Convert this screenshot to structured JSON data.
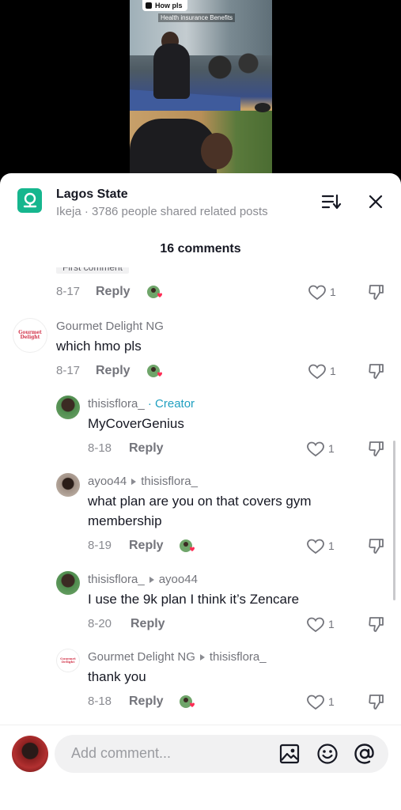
{
  "video": {
    "badge": "How pls",
    "caption": "Health insurance Benefits"
  },
  "header": {
    "title": "Lagos State",
    "subtitle": "Ikeja · 3786 people shared related posts",
    "comment_count": "16 comments"
  },
  "comments": {
    "first_tag": "First comment",
    "items": [
      {
        "user": "",
        "text": "",
        "date": "8-17",
        "reply": "Reply",
        "likes": "1"
      },
      {
        "user": "Gourmet Delight NG",
        "text": "which hmo pls",
        "date": "8-17",
        "reply": "Reply",
        "likes": "1"
      },
      {
        "user": "thisisflora_",
        "creator": "· Creator",
        "text": "MyCoverGenius",
        "date": "8-18",
        "reply": "Reply",
        "likes": "1"
      },
      {
        "user": "ayoo44",
        "reply_to": "thisisflora_",
        "text": "what plan are you on that covers gym",
        "text2": "membership",
        "date": "8-19",
        "reply": "Reply",
        "likes": "1"
      },
      {
        "user": "thisisflora_",
        "reply_to": "ayoo44",
        "text": "I use the 9k plan I think it’s Zencare",
        "date": "8-20",
        "reply": "Reply",
        "likes": "1"
      },
      {
        "user": "Gourmet Delight NG",
        "reply_to": "thisisflora_",
        "text": "thank you",
        "date": "8-18",
        "reply": "Reply",
        "likes": "1"
      }
    ]
  },
  "avatar_labels": {
    "gourmet": "Gourmet Delight"
  },
  "input": {
    "placeholder": "Add comment..."
  },
  "colors": {
    "accent": "#16b68e",
    "creator": "#20a0c0",
    "heart": "#fe2c55"
  },
  "icons": [
    "location-icon",
    "sort-icon",
    "close-icon",
    "heart-icon",
    "dislike-icon",
    "reaction-icon",
    "image-icon",
    "emoji-icon",
    "mention-icon"
  ]
}
